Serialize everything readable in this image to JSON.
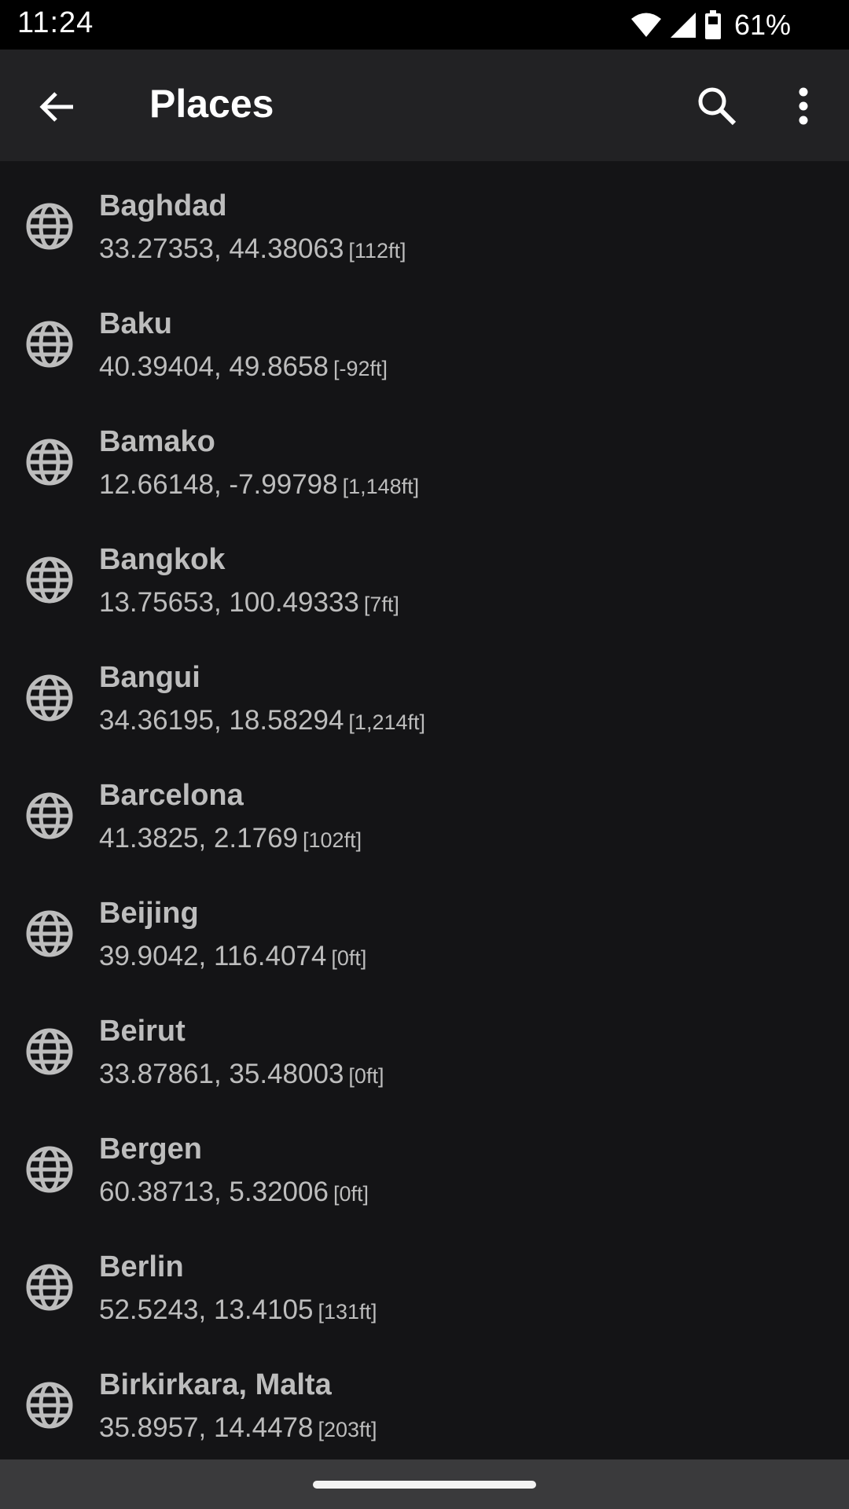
{
  "status_bar": {
    "time": "11:24",
    "battery_percent": "61%",
    "icons": [
      "wifi-icon",
      "signal-icon",
      "battery-icon"
    ]
  },
  "app_bar": {
    "title": "Places",
    "icons": [
      "back-arrow-icon",
      "search-icon",
      "more-vert-icon"
    ]
  },
  "places": [
    {
      "name": "Baghdad",
      "coords": "33.27353, 44.38063",
      "elevation": "[112ft]"
    },
    {
      "name": "Baku",
      "coords": "40.39404, 49.8658",
      "elevation": "[-92ft]"
    },
    {
      "name": "Bamako",
      "coords": "12.66148, -7.99798",
      "elevation": "[1,148ft]"
    },
    {
      "name": "Bangkok",
      "coords": "13.75653, 100.49333",
      "elevation": "[7ft]"
    },
    {
      "name": "Bangui",
      "coords": "34.36195, 18.58294",
      "elevation": "[1,214ft]"
    },
    {
      "name": "Barcelona",
      "coords": "41.3825, 2.1769",
      "elevation": "[102ft]"
    },
    {
      "name": "Beijing",
      "coords": "39.9042, 116.4074",
      "elevation": "[0ft]"
    },
    {
      "name": "Beirut",
      "coords": "33.87861, 35.48003",
      "elevation": "[0ft]"
    },
    {
      "name": "Bergen",
      "coords": "60.38713, 5.32006",
      "elevation": "[0ft]"
    },
    {
      "name": "Berlin",
      "coords": "52.5243, 13.4105",
      "elevation": "[131ft]"
    },
    {
      "name": "Birkirkara, Malta",
      "coords": "35.8957, 14.4478",
      "elevation": "[203ft]"
    }
  ],
  "colors": {
    "background": "#141416",
    "app_bar": "#222224",
    "status_bar": "#000000",
    "nav_bar": "#3a3a3c",
    "text_primary": "#ffffff",
    "text_item": "#bdbdbd"
  }
}
